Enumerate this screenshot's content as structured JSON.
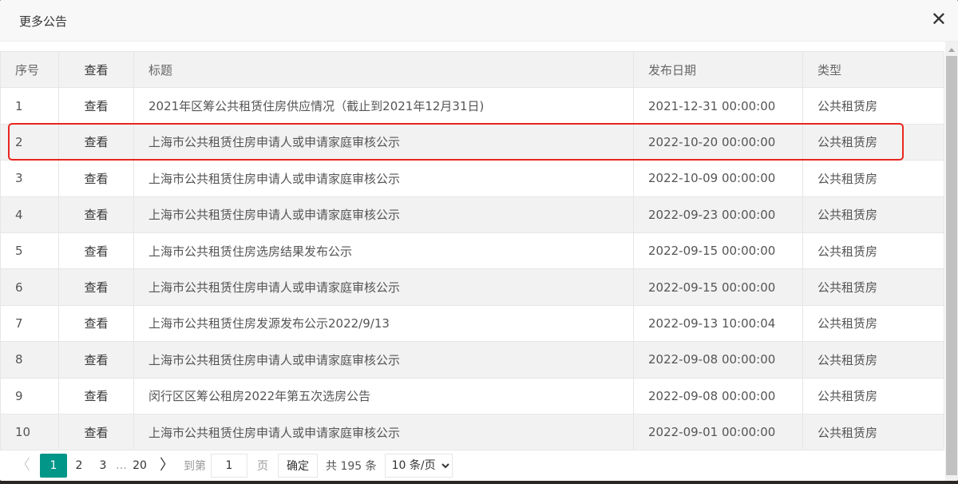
{
  "dialog": {
    "title": "更多公告",
    "close_icon": "close-icon"
  },
  "table": {
    "headers": [
      "序号",
      "查看",
      "标题",
      "发布日期",
      "类型"
    ],
    "rows": [
      {
        "idx": "1",
        "view": "查看",
        "title": "2021年区筹公共租赁住房供应情况（截止到2021年12月31日)",
        "date": "2021-12-31 00:00:00",
        "type": "公共租赁房"
      },
      {
        "idx": "2",
        "view": "查看",
        "title": "上海市公共租赁住房申请人或申请家庭审核公示",
        "date": "2022-10-20 00:00:00",
        "type": "公共租赁房"
      },
      {
        "idx": "3",
        "view": "查看",
        "title": "上海市公共租赁住房申请人或申请家庭审核公示",
        "date": "2022-10-09 00:00:00",
        "type": "公共租赁房"
      },
      {
        "idx": "4",
        "view": "查看",
        "title": "上海市公共租赁住房申请人或申请家庭审核公示",
        "date": "2022-09-23 00:00:00",
        "type": "公共租赁房"
      },
      {
        "idx": "5",
        "view": "查看",
        "title": "上海市公共租赁住房选房结果发布公示",
        "date": "2022-09-15 00:00:00",
        "type": "公共租赁房"
      },
      {
        "idx": "6",
        "view": "查看",
        "title": "上海市公共租赁住房申请人或申请家庭审核公示",
        "date": "2022-09-15 00:00:00",
        "type": "公共租赁房"
      },
      {
        "idx": "7",
        "view": "查看",
        "title": "上海市公共租赁住房发源发布公示2022/9/13",
        "date": "2022-09-13 10:00:04",
        "type": "公共租赁房"
      },
      {
        "idx": "8",
        "view": "查看",
        "title": "上海市公共租赁住房申请人或申请家庭审核公示",
        "date": "2022-09-08 00:00:00",
        "type": "公共租赁房"
      },
      {
        "idx": "9",
        "view": "查看",
        "title": "闵行区区筹公租房2022年第五次选房公告",
        "date": "2022-09-08 00:00:00",
        "type": "公共租赁房"
      },
      {
        "idx": "10",
        "view": "查看",
        "title": "上海市公共租赁住房申请人或申请家庭审核公示",
        "date": "2022-09-01 00:00:00",
        "type": "公共租赁房"
      }
    ]
  },
  "pager": {
    "prev": "〈",
    "pages": [
      "1",
      "2",
      "3"
    ],
    "ellipsis": "…",
    "last": "20",
    "next": "〉",
    "goto_label": "到第",
    "goto_value": "1",
    "page_label": "页",
    "confirm": "确定",
    "total": "共 195 条",
    "page_size": "10 条/页"
  },
  "colors": {
    "accent": "#009688",
    "highlight": "#e8261e"
  }
}
